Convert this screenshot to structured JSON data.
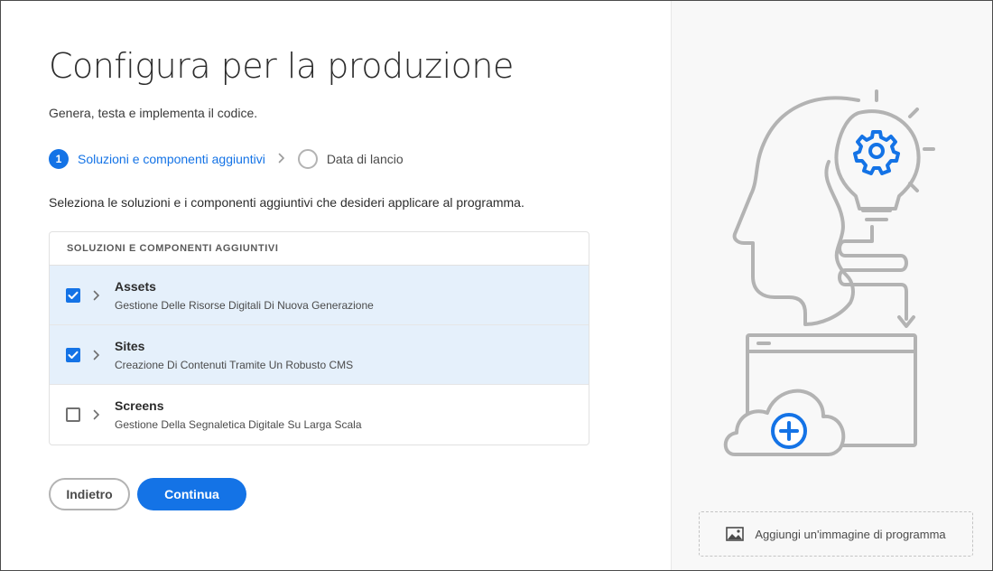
{
  "page": {
    "title": "Configura per la produzione",
    "subtitle": "Genera, testa e implementa il codice."
  },
  "stepper": {
    "steps": [
      {
        "number": "1",
        "label": "Soluzioni e componenti aggiuntivi",
        "state": "active"
      },
      {
        "number": "",
        "label": "Data di lancio",
        "state": "inactive"
      }
    ],
    "separator_icon": "chevron-right-icon"
  },
  "instructions": "Seleziona le soluzioni e i componenti aggiuntivi che desideri applicare al programma.",
  "table": {
    "header": "SOLUZIONI E COMPONENTI AGGIUNTIVI",
    "rows": [
      {
        "title": "Assets",
        "description": "Gestione Delle Risorse Digitali Di Nuova Generazione",
        "checked": true
      },
      {
        "title": "Sites",
        "description": "Creazione Di Contenuti Tramite Un Robusto CMS",
        "checked": true
      },
      {
        "title": "Screens",
        "description": "Gestione Della Segnaletica Digitale Su Larga Scala",
        "checked": false
      }
    ]
  },
  "buttons": {
    "back_label": "Indietro",
    "continue_label": "Continua"
  },
  "side_panel": {
    "add_image_label": "Aggiungi un'immagine di programma",
    "add_image_icon": "image-icon",
    "illustration": "head-lightbulb-gear-cloud-illustration"
  },
  "colors": {
    "accent": "#1473e6",
    "selected_row": "#e5f0fb",
    "illustration_stroke": "#b3b3b3"
  }
}
